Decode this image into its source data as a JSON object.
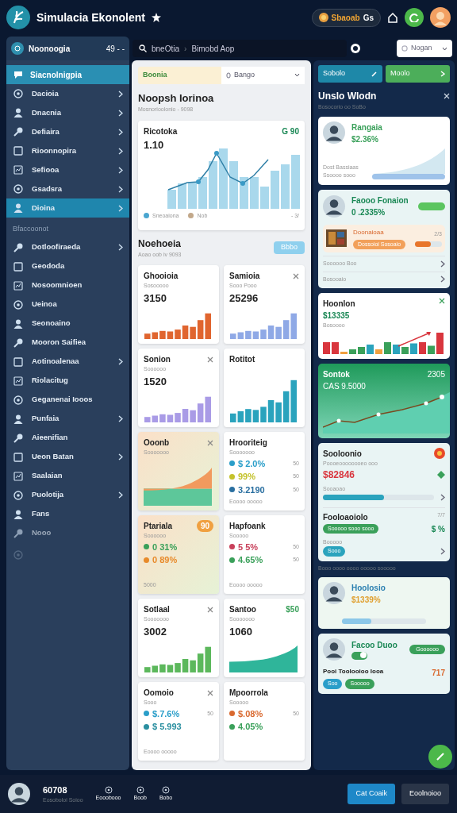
{
  "app": {
    "title": "Simulacia Ekonolent",
    "coins": "Sbaoab",
    "coins_unit": "Gs"
  },
  "toolbar": {
    "workspace": "Noonoogia",
    "workspace_meta": "49 - -",
    "breadcrumb": [
      "bneOtia",
      "Bimobd Aop"
    ],
    "separator": "›",
    "select": "Nogan"
  },
  "sidebar": {
    "header": "Siacnolnigpia",
    "groups": [
      {
        "items": [
          {
            "label": "Dacioia",
            "selected": false,
            "has_submenu": true,
            "disabled": false
          },
          {
            "label": "Dnacnia",
            "selected": false,
            "has_submenu": true,
            "disabled": false
          },
          {
            "label": "Defiaira",
            "selected": false,
            "has_submenu": true,
            "disabled": false
          },
          {
            "label": "Rioonnopira",
            "selected": false,
            "has_submenu": true,
            "disabled": false
          },
          {
            "label": "Sefiooa",
            "selected": false,
            "has_submenu": true,
            "disabled": false
          },
          {
            "label": "Gsadsra",
            "selected": false,
            "has_submenu": true,
            "disabled": false
          },
          {
            "label": "Dioina",
            "selected": true,
            "has_submenu": true,
            "disabled": false
          }
        ]
      },
      {
        "title": "Bfaccoonot",
        "items": [
          {
            "label": "Dotloofiraeda",
            "selected": false,
            "has_submenu": true,
            "disabled": false
          },
          {
            "label": "Geododa",
            "selected": false,
            "has_submenu": false,
            "disabled": false
          },
          {
            "label": "Nosoomnioen",
            "selected": false,
            "has_submenu": false,
            "disabled": false
          },
          {
            "label": "Ueinoa",
            "selected": false,
            "has_submenu": false,
            "disabled": false
          },
          {
            "label": "Seonoaino",
            "selected": false,
            "has_submenu": false,
            "disabled": false
          },
          {
            "label": "Mooron Saifiea",
            "selected": false,
            "has_submenu": false,
            "disabled": false
          },
          {
            "label": "Aotinoalenaa",
            "selected": false,
            "has_submenu": true,
            "disabled": false
          },
          {
            "label": "Riolacitug",
            "selected": false,
            "has_submenu": false,
            "disabled": false
          },
          {
            "label": "Geganenai Iooos",
            "selected": false,
            "has_submenu": false,
            "disabled": false
          },
          {
            "label": "Punfaia",
            "selected": false,
            "has_submenu": true,
            "disabled": false
          },
          {
            "label": "Aieenifian",
            "selected": false,
            "has_submenu": false,
            "disabled": false
          },
          {
            "label": "Ueon Batan",
            "selected": false,
            "has_submenu": true,
            "disabled": false
          },
          {
            "label": "Saalaian",
            "selected": false,
            "has_submenu": false,
            "disabled": false
          },
          {
            "label": "Puolotija",
            "selected": false,
            "has_submenu": true,
            "disabled": false
          },
          {
            "label": "Fans",
            "selected": false,
            "has_submenu": false,
            "disabled": false
          },
          {
            "label": "Nooo",
            "selected": false,
            "has_submenu": false,
            "disabled": true
          }
        ]
      }
    ]
  },
  "main": {
    "filter_tabs": [
      {
        "label": "Boonia",
        "selected": true
      }
    ],
    "dropdown": "Bango",
    "title": "Noopsh Iorinoa",
    "subtitle": "Mosnorioolonio - 9098",
    "overview": {
      "title": "Ricotoka",
      "badge": "G 90",
      "value": "1.10",
      "legend": [
        {
          "label": "Sneoaiona",
          "color": "#4aa6d0"
        },
        {
          "label": "Nob",
          "color": "#c2a88a"
        }
      ],
      "note": "- 3/"
    },
    "section": {
      "title": "Noehoeia",
      "subtitle": "Aoao oob iv 9093",
      "button": "Bbbo"
    },
    "cards": [
      {
        "kind": "bars",
        "title": "Ghooioia",
        "subtitle": "Sosooooo",
        "value": "3150",
        "color": "#e0652f",
        "closable": false,
        "tinted": false
      },
      {
        "kind": "bars",
        "title": "Samioia",
        "subtitle": "Sooo Pooo",
        "value": "25296",
        "color": "#8fa9e6",
        "closable": true,
        "tinted": false
      },
      {
        "kind": "bars",
        "title": "Sonion",
        "subtitle": "Soooooo",
        "value": "1520",
        "color": "#a99be6",
        "closable": true,
        "tinted": false
      },
      {
        "kind": "bars",
        "title": "Rotitot",
        "color": "#2aa3bd",
        "closable": false,
        "tinted": false
      },
      {
        "kind": "area",
        "title": "Ooonb",
        "subtitle": "Sooooooo",
        "color": "#f19a5e",
        "closable": true,
        "tinted": true
      },
      {
        "kind": "stats",
        "title": "Hrooriteig",
        "subtitle": "Sooooooo",
        "closable": false,
        "tinted": false,
        "stats": [
          {
            "text": "$ 2.0%",
            "color": "#2a9ec9",
            "note": "50"
          },
          {
            "text": "99%",
            "color": "#c4c22c",
            "note": "50"
          },
          {
            "text": "3.2190",
            "color": "#2a6fa0",
            "note": "50"
          }
        ],
        "foot": "Eoooo ooooo"
      },
      {
        "kind": "stats",
        "title": "Ptariala",
        "subtitle": "Soooooo",
        "badge": "90",
        "closable": false,
        "tinted": true,
        "stats": [
          {
            "text": "0 31%",
            "color": "#3aa05a"
          },
          {
            "text": "0 89%",
            "color": "#e88a2a"
          }
        ],
        "foot": "5000"
      },
      {
        "kind": "stats",
        "title": "Hapfoank",
        "subtitle": "Sooooo",
        "closable": false,
        "tinted": false,
        "stats": [
          {
            "text": "5 5%",
            "color": "#c8405a",
            "note": "50"
          },
          {
            "text": "4.65%",
            "color": "#3aa05a",
            "note": "50"
          }
        ],
        "foot": "Eoooo ooooo"
      },
      {
        "kind": "bars",
        "title": "Sotlaal",
        "subtitle": "Sooooooo",
        "value": "3002",
        "color": "#5cb85c",
        "closable": true,
        "tinted": false
      },
      {
        "kind": "area",
        "title": "Santoo",
        "subtitle": "Sooooooo",
        "value": "1060",
        "badge": "$50",
        "color": "#2fb59a",
        "closable": false,
        "tinted": false
      },
      {
        "kind": "stats",
        "title": "Oomoio",
        "subtitle": "Sooo",
        "closable": true,
        "tinted": false,
        "stats": [
          {
            "text": "$.7.6%",
            "color": "#2a9ec9",
            "note": "50"
          },
          {
            "text": "$ 5.993",
            "color": "#2a8fa0"
          }
        ],
        "foot": "Eoooo ooooo"
      },
      {
        "kind": "stats",
        "title": "Mpoorrola",
        "subtitle": "Sooooo",
        "closable": false,
        "tinted": false,
        "stats": [
          {
            "text": "$.08%",
            "color": "#d9692f",
            "note": "50"
          },
          {
            "text": "4.05%",
            "color": "#3aa05a"
          }
        ]
      }
    ]
  },
  "side": {
    "buttons": [
      {
        "label": "Sobolo",
        "kind": "edit"
      },
      {
        "label": "Moolo",
        "kind": "go"
      }
    ],
    "title": "Unslo Wlodn",
    "subtitle": "Bosocorio oo SoBo",
    "cards": [
      {
        "kind": "trend",
        "name": "Rangaia",
        "value": "$2.36%",
        "lines": [
          "Dost Bassiaas",
          "Ssoooo sooo"
        ]
      },
      {
        "kind": "contact",
        "name": "Faooo Fonaion",
        "value": "0 .2335%",
        "task": "Doonaioaa",
        "tag": "Dossoioi Sosoaio",
        "count": "2/3",
        "level": 0.6,
        "links": [
          "Soooooo Boo",
          "Bosooaio"
        ]
      },
      {
        "kind": "bars",
        "title": "Hoonlon",
        "value": "$13335",
        "caption": "Bosoooo"
      },
      {
        "kind": "growth",
        "title": "Sontok",
        "subtitle": "CAS 9.5000",
        "badge": "2305"
      },
      {
        "kind": "summary",
        "title": "Sooloonio",
        "subtitle": "Poooeoooooooeo ooo",
        "value": "$82846",
        "label": "Sooaoao",
        "level": 0.55,
        "title2": "Fooloaoiolo",
        "count": "7/7",
        "tag": "Sooooo sooo sooo",
        "amount": "$ %",
        "label2": "Booooo",
        "tag2": "Sooo"
      },
      {
        "kind": "note",
        "text": "Booo oooo oooo ooooo sooooo"
      },
      {
        "kind": "progress",
        "name": "Hoolosio",
        "value": "$1339%",
        "level": 0.35
      },
      {
        "kind": "contact2",
        "name": "Facoo Duoo",
        "button": "Goooooo",
        "on": true,
        "footer": "Pooi Toolooioo Iooa",
        "count": "717",
        "tags": [
          "Soo",
          "Sooooo"
        ]
      }
    ]
  },
  "footer": {
    "user": "60708",
    "user_sub": "Eosoboloi Soioo",
    "tabs": [
      {
        "label": "Eooobooo"
      },
      {
        "label": "Boob"
      },
      {
        "label": "Bobo"
      }
    ],
    "actions": [
      {
        "label": "Cat Coaik",
        "primary": true
      },
      {
        "label": "Eoolnoioo",
        "primary": false
      }
    ]
  }
}
